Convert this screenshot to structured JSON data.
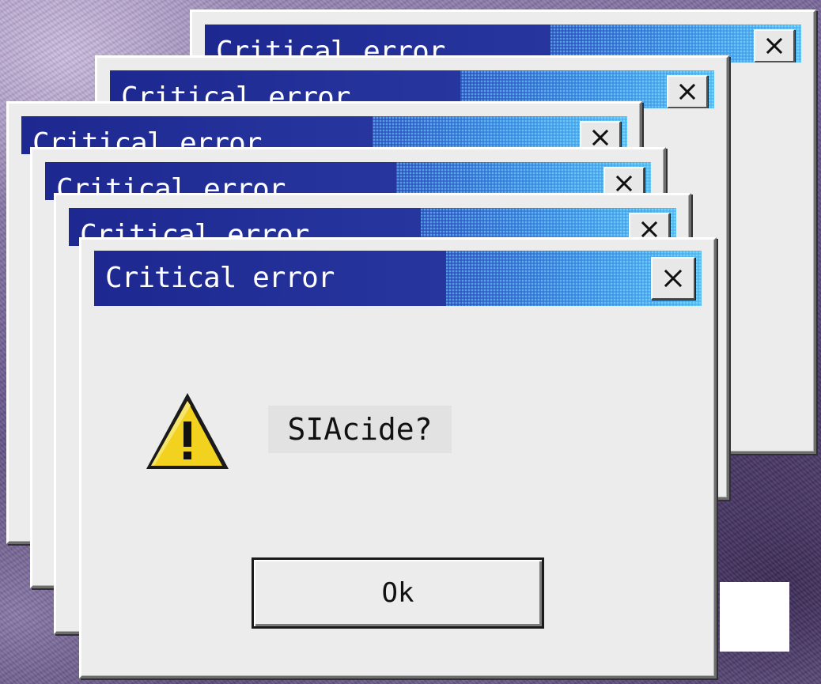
{
  "colors": {
    "titlebar_dark": "#1d2890",
    "titlebar_light": "#52b6f2",
    "window_face": "#ececec",
    "warning_yellow": "#f2d21e"
  },
  "background_windows": [
    {
      "title": "Critical error",
      "close_icon": "close-x-icon"
    },
    {
      "title": "Critical error",
      "close_icon": "close-x-icon"
    },
    {
      "title": "Critical error",
      "close_icon": "close-x-icon"
    },
    {
      "title": "Critical error",
      "close_icon": "close-x-icon"
    },
    {
      "title": "Critical error",
      "close_icon": "close-x-icon"
    }
  ],
  "dialog": {
    "title": "Critical error",
    "close_icon": "close-x-icon",
    "icon": "warning-triangle-icon",
    "message": "SIAcide?",
    "ok_label": "Ok"
  }
}
